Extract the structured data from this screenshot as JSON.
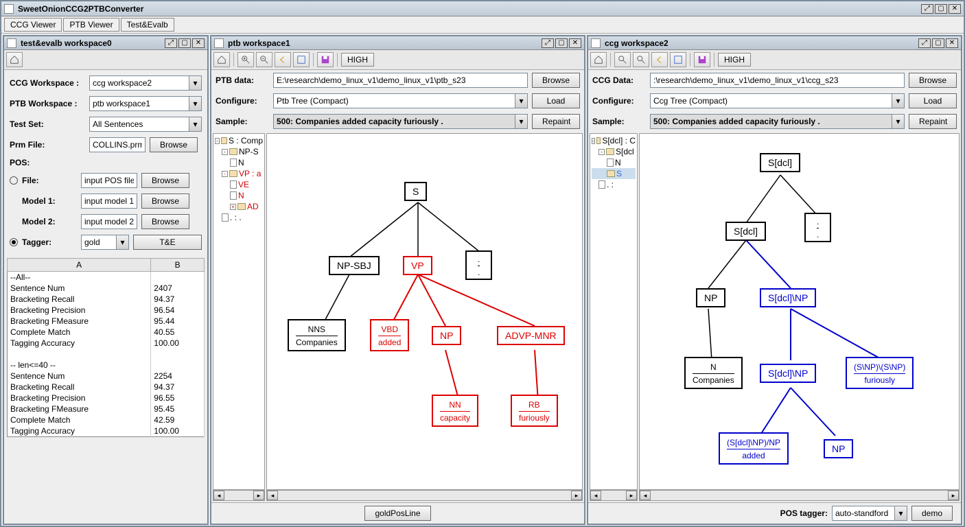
{
  "app": {
    "title": "SweetOnionCCG2PTBConverter"
  },
  "tabs": {
    "t0": "CCG Viewer",
    "t1": "PTB Viewer",
    "t2": "Test&Evalb"
  },
  "left": {
    "title": "test&evalb workspace0",
    "ccgws_label": "CCG Workspace :",
    "ccgws_value": "ccg workspace2",
    "ptbws_label": "PTB Workspace :",
    "ptbws_value": "ptb workspace1",
    "testset_label": "Test Set:",
    "testset_value": "All Sentences",
    "prm_label": "Prm File:",
    "prm_value": "COLLINS.prm",
    "browse": "Browse",
    "pos_label": "POS:",
    "file_label": "File:",
    "file_value": "input POS file",
    "model1_label": "Model 1:",
    "model1_value": "input model 1",
    "model2_label": "Model 2:",
    "model2_value": "input model 2",
    "tagger_label": "Tagger:",
    "tagger_value": "gold",
    "te_btn": "T&E",
    "col_a": "A",
    "col_b": "B",
    "all_header": "--All--",
    "r1a": "Sentence Num",
    "r1b": "2407",
    "r2a": "Bracketing Recall",
    "r2b": "94.37",
    "r3a": "Bracketing Precision",
    "r3b": "96.54",
    "r4a": "Bracketing FMeasure",
    "r4b": "95.44",
    "r5a": "Complete Match",
    "r5b": "40.55",
    "r6a": "Tagging Accuracy",
    "r6b": "100.00",
    "len_header": "-- len<=40 --",
    "s1a": "Sentence Num",
    "s1b": "2254",
    "s2a": "Bracketing Recall",
    "s2b": "94.37",
    "s3a": "Bracketing Precision",
    "s3b": "96.55",
    "s4a": "Bracketing FMeasure",
    "s4b": "95.45",
    "s5a": "Complete Match",
    "s5b": "42.59",
    "s6a": "Tagging Accuracy",
    "s6b": "100.00"
  },
  "ptb": {
    "title": "ptb workspace1",
    "high": "HIGH",
    "data_label": "PTB data:",
    "data_value": "E:\\research\\demo_linux_v1\\demo_linux_v1\\ptb_s23",
    "browse": "Browse",
    "config_label": "Configure:",
    "config_value": "Ptb Tree (Compact)",
    "load": "Load",
    "sample_label": "Sample:",
    "sample_value": "500: Companies added capacity furiously .",
    "repaint": "Repaint",
    "tree": {
      "root": "S : Comp",
      "n1": "NP-S",
      "n1a": "N",
      "n2": "VP : a",
      "n2a": "VE",
      "n2b": "N",
      "n2c": "AD",
      "n3": ". : ."
    },
    "nodes": {
      "s": "S",
      "npsbj": "NP-SBJ",
      "vp": "VP",
      "dot": ".",
      "dot2": ".",
      "nns": "NNS",
      "nns_w": "Companies",
      "vbd": "VBD",
      "vbd_w": "added",
      "np": "NP",
      "advp": "ADVP-MNR",
      "nn": "NN",
      "nn_w": "capacity",
      "rb": "RB",
      "rb_w": "furiously"
    },
    "bottom_btn": "goldPosLine"
  },
  "ccg": {
    "title": "ccg workspace2",
    "high": "HIGH",
    "data_label": "CCG Data:",
    "data_value": ":\\research\\demo_linux_v1\\demo_linux_v1\\ccg_s23",
    "browse": "Browse",
    "config_label": "Configure:",
    "config_value": "Ccg Tree (Compact)",
    "load": "Load",
    "sample_label": "Sample:",
    "sample_value": "500: Companies added capacity furiously .",
    "repaint": "Repaint",
    "tree": {
      "root": "S[dcl] : C",
      "n1": "S[dcl",
      "n1a": "N",
      "n2": "S",
      "n3": ". :"
    },
    "nodes": {
      "sdcl": "S[dcl]",
      "dot": ".",
      "dot2": ".",
      "sdcl2": "S[dcl]",
      "np": "NP",
      "sdclnp": "S[dcl]\\NP",
      "n": "N",
      "n_w": "Companies",
      "sdclnp2": "S[dcl]\\NP",
      "snpsnp": "(S\\NP)\\(S\\NP)",
      "snpsnp_w": "furiously",
      "sdclnpnp": "(S[dcl]\\NP)/NP",
      "sdclnpnp_w": "added",
      "np2": "NP"
    },
    "postag_label": "POS tagger:",
    "postag_value": "auto-standford",
    "demo": "demo"
  }
}
